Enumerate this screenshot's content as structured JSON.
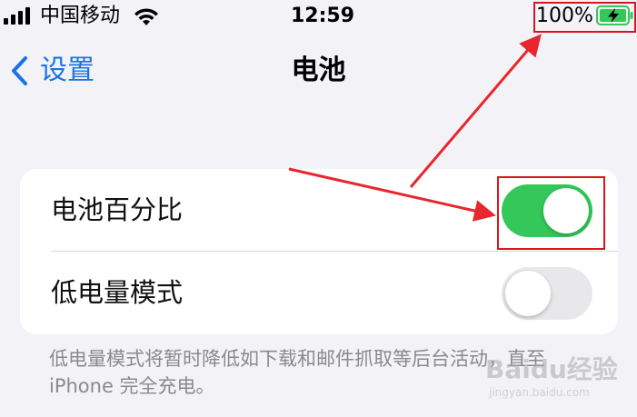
{
  "status_bar": {
    "carrier": "中国移动",
    "time": "12:59",
    "battery_percent": "100%",
    "signal_icon": "cellular-signal-icon",
    "wifi_icon": "wifi-icon",
    "battery_icon": "battery-charging-icon"
  },
  "nav": {
    "back_label": "设置",
    "back_icon": "chevron-left-icon",
    "title": "电池"
  },
  "settings": {
    "rows": [
      {
        "label": "电池百分比",
        "toggle_on": true
      },
      {
        "label": "低电量模式",
        "toggle_on": false
      }
    ],
    "footer_note": "低电量模式将暂时降低如下载和邮件抓取等后台活动，直至iPhone 完全充电。"
  },
  "colors": {
    "accent": "#1a73e8",
    "toggle_on": "#34c759",
    "toggle_off": "#e8e8ea",
    "annotation_red": "#d8161f",
    "background": "#f2f2f7"
  },
  "watermark": {
    "text": "Baidu经验",
    "sub": "jingyan.baidu.com"
  }
}
